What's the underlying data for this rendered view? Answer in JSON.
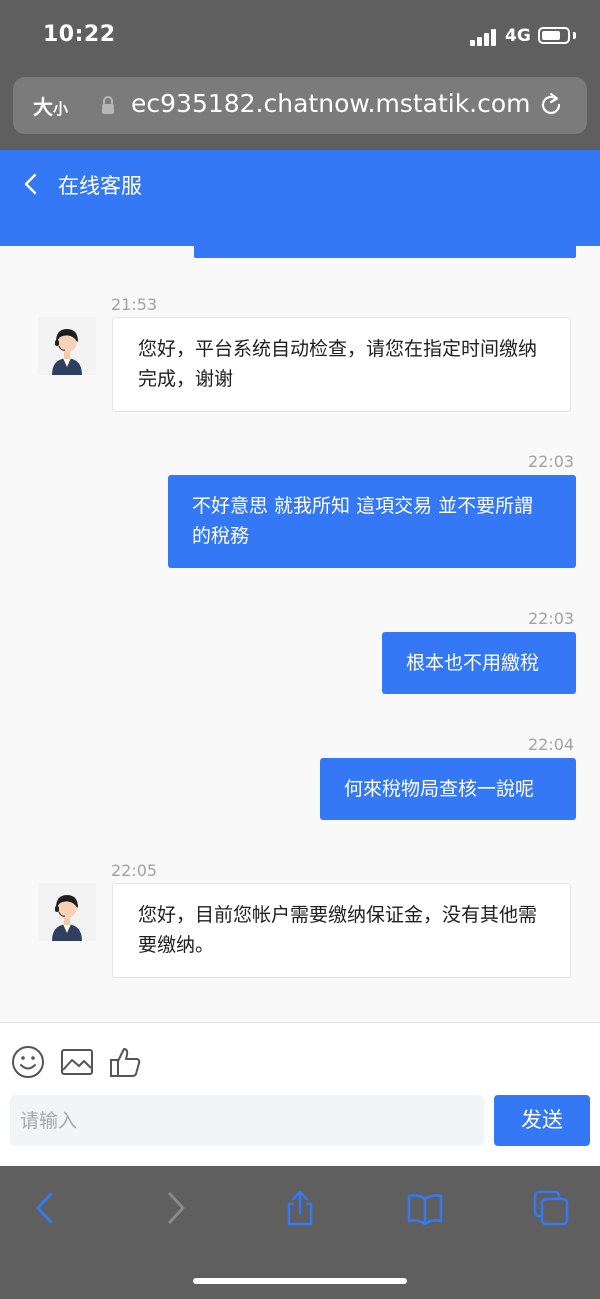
{
  "status_bar": {
    "time": "10:22",
    "network": "4G"
  },
  "browser": {
    "text_size_big": "大",
    "text_size_small": "小",
    "url": "ec935182.chatnow.mstatik.com"
  },
  "header": {
    "title": "在线客服"
  },
  "messages": [
    {
      "time": "21:53",
      "from": "agent",
      "text": "您好，平台系统自动检查，请您在指定时间缴纳完成，谢谢"
    },
    {
      "time": "22:03",
      "from": "user",
      "text": "不好意思 就我所知 這項交易 並不要所謂的稅務"
    },
    {
      "time": "22:03",
      "from": "user",
      "text": "根本也不用繳稅"
    },
    {
      "time": "22:04",
      "from": "user",
      "text": "何來稅物局查核一說呢"
    },
    {
      "time": "22:05",
      "from": "agent",
      "text": "您好，目前您帐户需要缴纳保证金，没有其他需要缴纳。"
    }
  ],
  "composer": {
    "placeholder": "请输入",
    "send_label": "发送"
  },
  "colors": {
    "accent": "#3478f6",
    "chrome": "#5f5f5f",
    "toolbar_icon": "#3478f6",
    "toolbar_icon_disabled": "#8a8a8a"
  },
  "icons": [
    "back-icon",
    "lock-icon",
    "reload-icon",
    "emoji-icon",
    "image-icon",
    "thumbs-up-icon",
    "browser-back-icon",
    "browser-forward-icon",
    "share-icon",
    "bookmarks-icon",
    "tabs-icon"
  ]
}
